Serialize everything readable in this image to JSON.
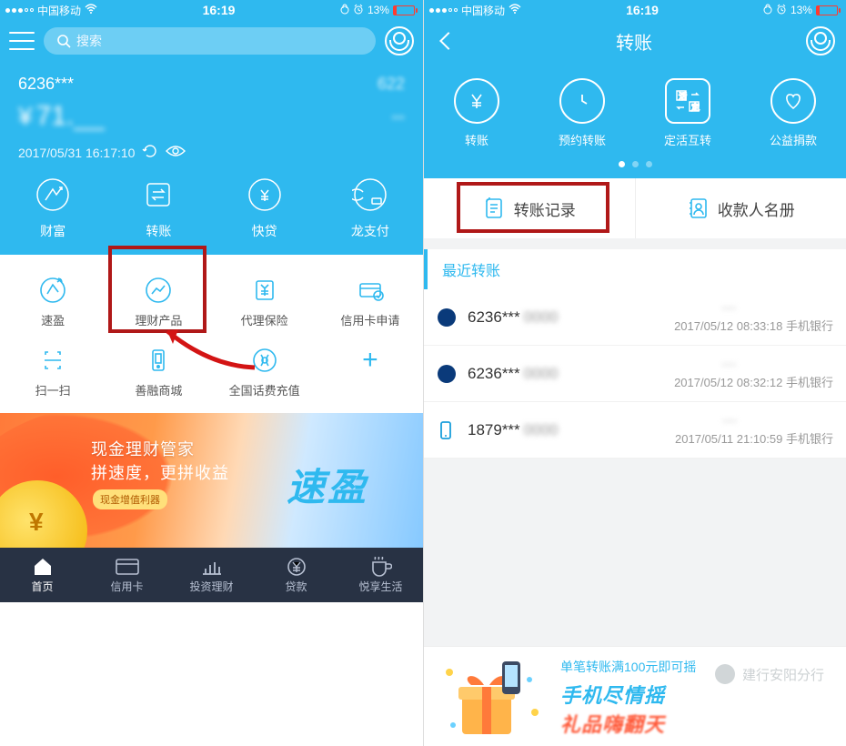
{
  "status": {
    "carrier": "中国移动",
    "time": "16:19",
    "battery_pct": "13%"
  },
  "left": {
    "search_placeholder": "搜索",
    "account_masked": "6236***",
    "account_right": "622",
    "balance_symbol": "¥",
    "balance_value": "71.__",
    "balance_right": "--",
    "timestamp": "2017/05/31 16:17:10",
    "quick": [
      {
        "label": "财富"
      },
      {
        "label": "转账"
      },
      {
        "label": "快贷"
      },
      {
        "label": "龙支付"
      }
    ],
    "grid_row1": [
      {
        "label": "速盈"
      },
      {
        "label": "理财产品"
      },
      {
        "label": "代理保险"
      },
      {
        "label": "信用卡申请"
      }
    ],
    "grid_row2": [
      {
        "label": "扫一扫"
      },
      {
        "label": "善融商城"
      },
      {
        "label": "全国话费充值"
      }
    ],
    "banner": {
      "line1": "现金理财管家",
      "line2": "拼速度，更拼收益",
      "tag": "现金增值利器",
      "big": "速盈"
    },
    "tabs": [
      {
        "label": "首页"
      },
      {
        "label": "信用卡"
      },
      {
        "label": "投资理财"
      },
      {
        "label": "贷款"
      },
      {
        "label": "悦享生活"
      }
    ]
  },
  "right": {
    "title": "转账",
    "quick": [
      {
        "label": "转账"
      },
      {
        "label": "预约转账"
      },
      {
        "label": "定活互转"
      },
      {
        "label": "公益捐款"
      }
    ],
    "btn_records": "转账记录",
    "btn_payees": "收款人名册",
    "section_title": "最近转账",
    "transfers": [
      {
        "acct": "6236***",
        "time": "2017/05/12 08:33:18",
        "channel": "手机银行",
        "type": "bank"
      },
      {
        "acct": "6236***",
        "time": "2017/05/12 08:32:12",
        "channel": "手机银行",
        "type": "bank"
      },
      {
        "acct": "1879***",
        "time": "2017/05/11 21:10:59",
        "channel": "手机银行",
        "type": "phone"
      }
    ],
    "promo": {
      "line1": "单笔转账满100元即可摇",
      "line2": "手机尽情摇",
      "line3": "礼品嗨翻天"
    }
  },
  "watermark": "建行安阳分行"
}
